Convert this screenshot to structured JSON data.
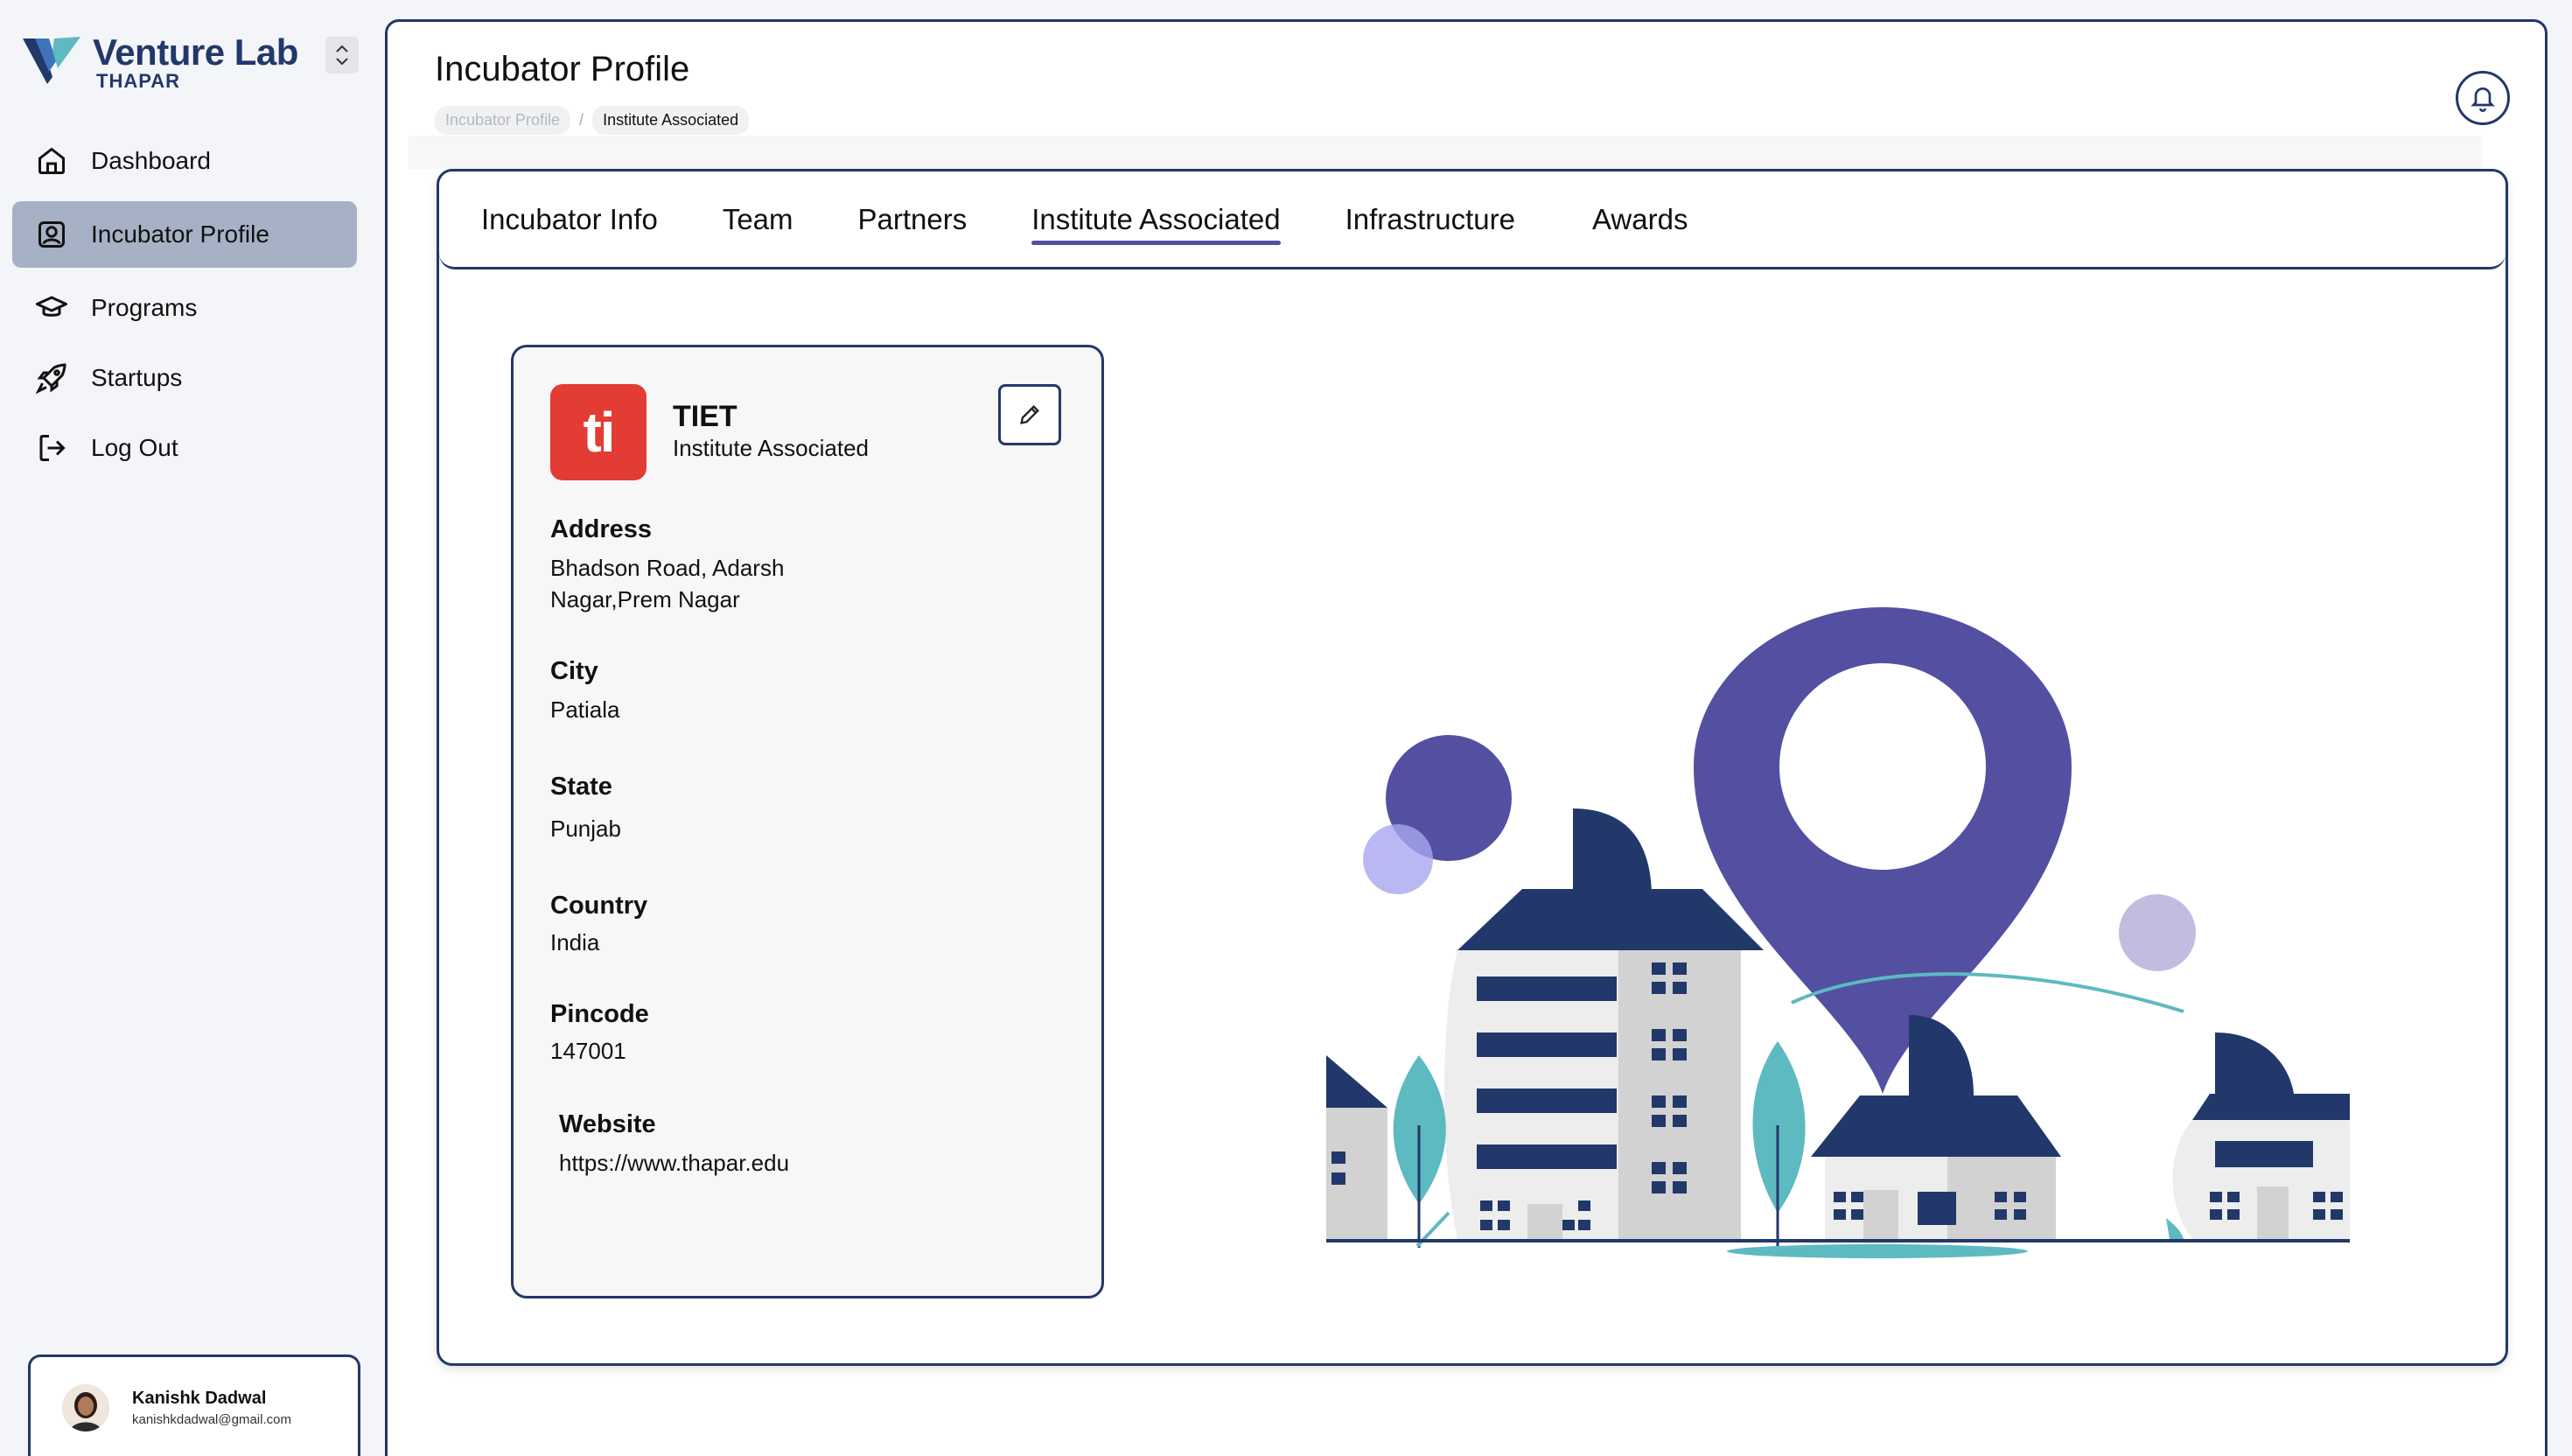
{
  "brand": {
    "name": "Venture Lab",
    "sub": "THAPAR"
  },
  "sidebar": {
    "items": [
      {
        "label": "Dashboard",
        "icon": "home-icon"
      },
      {
        "label": "Incubator Profile",
        "icon": "profile-icon",
        "active": true
      },
      {
        "label": "Programs",
        "icon": "graduation-cap-icon"
      },
      {
        "label": "Startups",
        "icon": "rocket-icon"
      },
      {
        "label": "Log Out",
        "icon": "logout-icon"
      }
    ]
  },
  "user": {
    "name": "Kanishk Dadwal",
    "email": "kanishkdadwal@gmail.com"
  },
  "header": {
    "title": "Incubator Profile",
    "breadcrumb": [
      "Incubator Profile",
      "Institute Associated"
    ],
    "separator": "/"
  },
  "tabs": [
    "Incubator Info",
    "Team",
    "Partners",
    "Institute Associated",
    "Infrastructure",
    "Awards"
  ],
  "active_tab": "Institute Associated",
  "institute": {
    "logo_text": "ti",
    "name": "TIET",
    "subtitle": "Institute Associated",
    "fields": {
      "address_label": "Address",
      "address": "Bhadson Road, Adarsh Nagar,Prem Nagar",
      "city_label": "City",
      "city": "Patiala",
      "state_label": "State",
      "state": "Punjab",
      "country_label": "Country",
      "country": "India",
      "pincode_label": "Pincode",
      "pincode": "147001",
      "website_label": "Website",
      "website": "https://www.thapar.edu"
    }
  },
  "colors": {
    "navy": "#22386a",
    "purple": "#5350a2",
    "teal": "#5dbac0",
    "red": "#e23c34"
  }
}
